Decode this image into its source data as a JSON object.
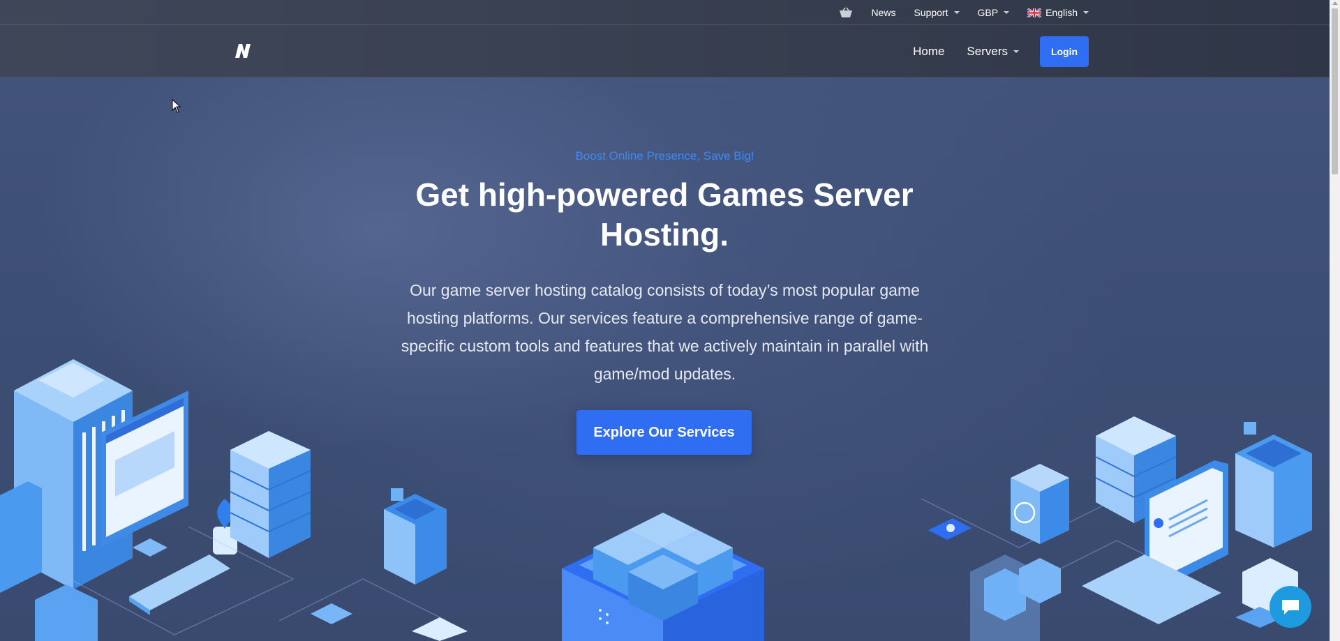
{
  "topbar": {
    "news": "News",
    "support": "Support",
    "currency": "GBP",
    "language": "English",
    "cart_icon": "basket-icon",
    "flag_icon": "uk-flag-icon"
  },
  "nav": {
    "home": "Home",
    "servers": "Servers",
    "login": "Login",
    "logo_icon": "brand-logo-icon"
  },
  "hero": {
    "eyebrow": "Boost Online Presence, Save Big!",
    "headline": "Get high-powered Games Server Hosting.",
    "subtext": "Our game server hosting catalog consists of today’s most popular game hosting platforms. Our services feature a comprehensive range of game-specific custom tools and features that we actively maintain in parallel with game/mod updates.",
    "cta": "Explore Our Services"
  },
  "colors": {
    "accent": "#2f6ef2",
    "eyebrow": "#3d8bf2",
    "background": "#3b4a6e",
    "chat": "#1e9be0"
  }
}
